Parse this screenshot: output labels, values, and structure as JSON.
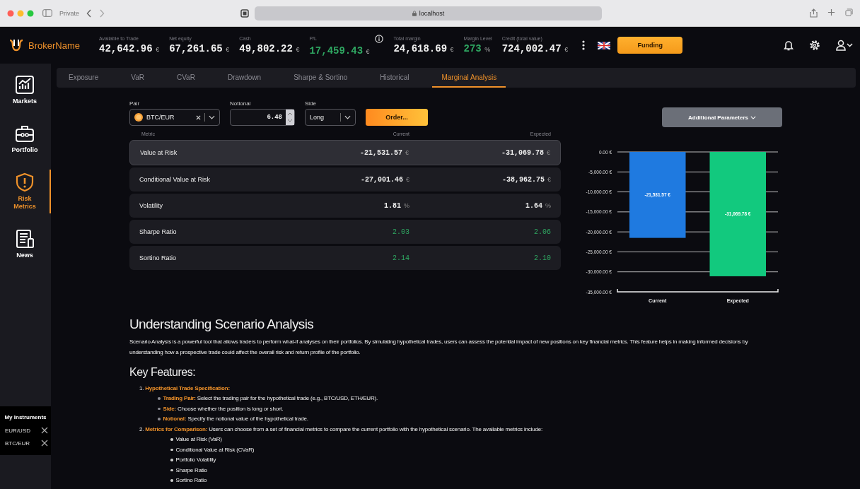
{
  "browser": {
    "window_label": "Private",
    "address": "localhost"
  },
  "header": {
    "brand": "BrokerName",
    "stats": [
      {
        "label": "Available to Trade",
        "value": "42,642.96",
        "unit": "€",
        "positive": false,
        "info": false
      },
      {
        "label": "Net equity",
        "value": "67,261.65",
        "unit": "€",
        "positive": false,
        "info": false
      },
      {
        "label": "Cash",
        "value": "49,802.22",
        "unit": "€",
        "positive": false,
        "info": false
      },
      {
        "label": "P/L",
        "value": "17,459.43",
        "unit": "€",
        "positive": true,
        "info": true
      },
      {
        "label": "Total margin",
        "value": "24,618.69",
        "unit": "€",
        "positive": false,
        "info": false
      },
      {
        "label": "Margin Level",
        "value": "273",
        "unit": "%",
        "positive": true,
        "info": false
      },
      {
        "label": "Credit (total value)",
        "value": "724,002.47",
        "unit": "€",
        "positive": false,
        "info": false
      }
    ],
    "funding_button": "Funding"
  },
  "sidebar": {
    "items": [
      {
        "kind": "markets",
        "label": "Markets",
        "selected": false
      },
      {
        "kind": "portfolio",
        "label": "Portfolio",
        "selected": false
      },
      {
        "kind": "risk",
        "label": "Risk Metrics",
        "selected": true
      },
      {
        "kind": "news",
        "label": "News",
        "selected": false
      }
    ],
    "instruments": {
      "title": "My Instruments",
      "items": [
        "EUR/USD",
        "BTC/EUR"
      ]
    }
  },
  "tabs": [
    {
      "label": "Exposure",
      "selected": false
    },
    {
      "label": "VaR",
      "selected": false
    },
    {
      "label": "CVaR",
      "selected": false
    },
    {
      "label": "Drawdown",
      "selected": false
    },
    {
      "label": "Sharpe & Sortino",
      "selected": false
    },
    {
      "label": "Historical",
      "selected": false
    },
    {
      "label": "Marginal Analysis",
      "selected": true
    }
  ],
  "form": {
    "pair": {
      "label": "Pair",
      "value": "BTC/EUR"
    },
    "notional": {
      "label": "Notional",
      "value": "6.48"
    },
    "side": {
      "label": "Side",
      "value": "Long"
    },
    "order_button": "Order...",
    "parameters_button": "Additional Parameters"
  },
  "table": {
    "columns": [
      "Metric",
      "Current",
      "Expected"
    ],
    "rows": [
      {
        "metric": "Value at Risk",
        "current": "-21,531.57",
        "expected": "-31,069.78",
        "unit": "€",
        "positive": false,
        "selected": true
      },
      {
        "metric": "Conditional Value at Risk",
        "current": "-27,001.46",
        "expected": "-38,962.75",
        "unit": "€",
        "positive": false,
        "selected": false
      },
      {
        "metric": "Volatility",
        "current": "1.81",
        "expected": "1.64",
        "unit": "%",
        "positive": false,
        "selected": false
      },
      {
        "metric": "Sharpe Ratio",
        "current": "2.03",
        "expected": "2.06",
        "positive": true,
        "selected": false
      },
      {
        "metric": "Sortino Ratio",
        "current": "2.14",
        "expected": "2.10",
        "positive": true,
        "selected": false
      }
    ]
  },
  "chart": {
    "chart_data": {
      "type": "bar",
      "categories": [
        "Current",
        "Expected"
      ],
      "series": [
        {
          "color": "#1f7ae0",
          "values": [
            -21500,
            null
          ]
        },
        {
          "color": "#12c97e",
          "values": [
            null,
            -31100
          ]
        }
      ],
      "stacked": true,
      "grid": true,
      "ylim": [
        -35000,
        0
      ],
      "yticks": [
        {
          "value": 0,
          "label": "0.00 €"
        },
        {
          "value": -5000,
          "label": "-5,000.00 €"
        },
        {
          "value": -10000,
          "label": "-10,000.00 €"
        },
        {
          "value": -15000,
          "label": "-15,000.00 €"
        },
        {
          "value": -20000,
          "label": "-20,000.00 €"
        },
        {
          "value": -25000,
          "label": "-25,000.00 €"
        },
        {
          "value": -30000,
          "label": "-30,000.00 €"
        },
        {
          "value": -35000,
          "label": "-35,000.00 €"
        }
      ],
      "value_labels": [
        "-21,531.57 €",
        "-31,069.78 €"
      ]
    }
  },
  "help": {
    "title": "Understanding Scenario Analysis",
    "intro": "Scenario Analysis is a powerful tool that allows traders to perform what-if analyses on their portfolios. By simulating hypothetical trades, users can assess the potential impact of new positions on key financial metrics. This feature helps in making informed decisions by understanding how a prospective trade could affect the overall risk and return profile of the portfolio.",
    "features_title": "Key Features:",
    "features": [
      {
        "number": "1.",
        "term": "Hypothetical Trade Specification:",
        "children": [
          {
            "term": "Trading Pair:",
            "text": "Select the trading pair for the hypothetical trade (e.g., BTC/USD, ETH/EUR)."
          },
          {
            "term": "Side:",
            "text": "Choose whether the position is long or short."
          },
          {
            "term": "Notional:",
            "text": "Specify the notional value of the hypothetical trade."
          }
        ]
      },
      {
        "number": "2.",
        "term": "Metrics for Comparison:",
        "text": "Users can choose from a set of financial metrics to compare the current portfolio with the hypothetical scenario. The available metrics include:",
        "children": [
          {
            "text": "Value at Risk (VaR)"
          },
          {
            "text": "Conditional Value at Risk (CVaR)"
          },
          {
            "text": "Portfolio Volatility"
          },
          {
            "text": "Sharpe Ratio"
          },
          {
            "text": "Sortino Ratio"
          }
        ]
      }
    ]
  }
}
